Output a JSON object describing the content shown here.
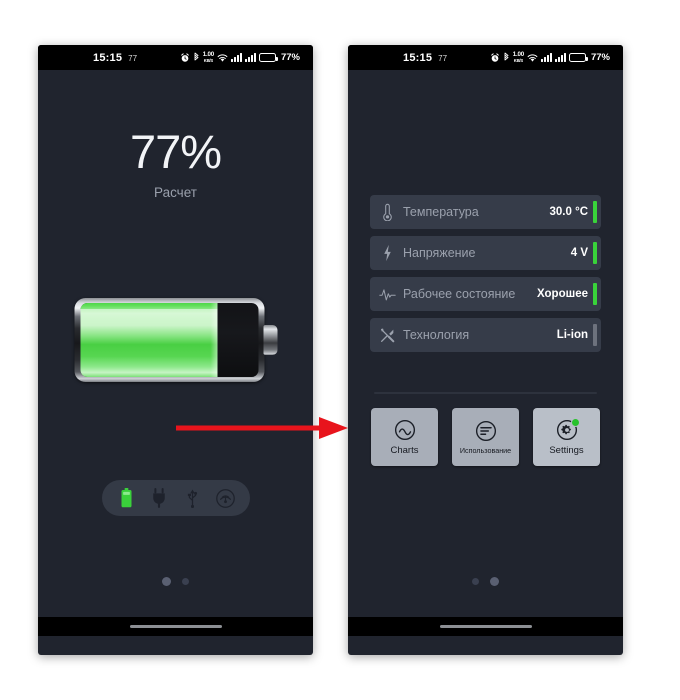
{
  "status_bar": {
    "time": "15:15",
    "temperature": "77",
    "data_rate_value": "1.00",
    "data_rate_unit": "KB/S",
    "battery_percent": "77%",
    "battery_fill": 77,
    "icons": [
      "alarm-icon",
      "bluetooth-icon",
      "data-rate-icon",
      "wifi-icon",
      "signal-sim1-icon",
      "signal-sim2-icon",
      "battery-icon"
    ]
  },
  "screen_left": {
    "percent": "77%",
    "status_text": "Расчет",
    "battery_level": 77,
    "power_sources": [
      {
        "name": "battery-source-icon",
        "active": true
      },
      {
        "name": "ac-plug-source-icon",
        "active": false
      },
      {
        "name": "usb-source-icon",
        "active": false
      },
      {
        "name": "wireless-source-icon",
        "active": false
      }
    ],
    "page_dots": [
      {
        "active": true
      },
      {
        "active": false
      }
    ]
  },
  "screen_right": {
    "rows": [
      {
        "icon": "thermometer-icon",
        "label": "Температура",
        "value": "30.0 °C",
        "bar_color": "#39d33a"
      },
      {
        "icon": "bolt-icon",
        "label": "Напряжение",
        "value": "4 V",
        "bar_color": "#39d33a"
      },
      {
        "icon": "pulse-icon",
        "label": "Рабочее состояние",
        "value": "Хорошее",
        "bar_color": "#39d33a"
      },
      {
        "icon": "tools-icon",
        "label": "Технология",
        "value": "Li-ion",
        "bar_color": "#6d727d"
      }
    ],
    "buttons": [
      {
        "icon": "charts-icon",
        "label": "Charts",
        "selected": false,
        "badge": false
      },
      {
        "icon": "usage-icon",
        "label": "Использование",
        "selected": false,
        "badge": false
      },
      {
        "icon": "gear-icon",
        "label": "Settings",
        "selected": true,
        "badge": true
      }
    ],
    "page_dots": [
      {
        "active": false
      },
      {
        "active": true
      }
    ]
  },
  "annotation": {
    "arrow": "red-right-arrow",
    "arrow_color": "#e8141c"
  },
  "colors": {
    "screen_bg": "#20242e",
    "row_bg": "#363c49",
    "accent_green": "#39d33a",
    "status_battery": "#eba53b",
    "button_bg": "#a8aeb8"
  }
}
